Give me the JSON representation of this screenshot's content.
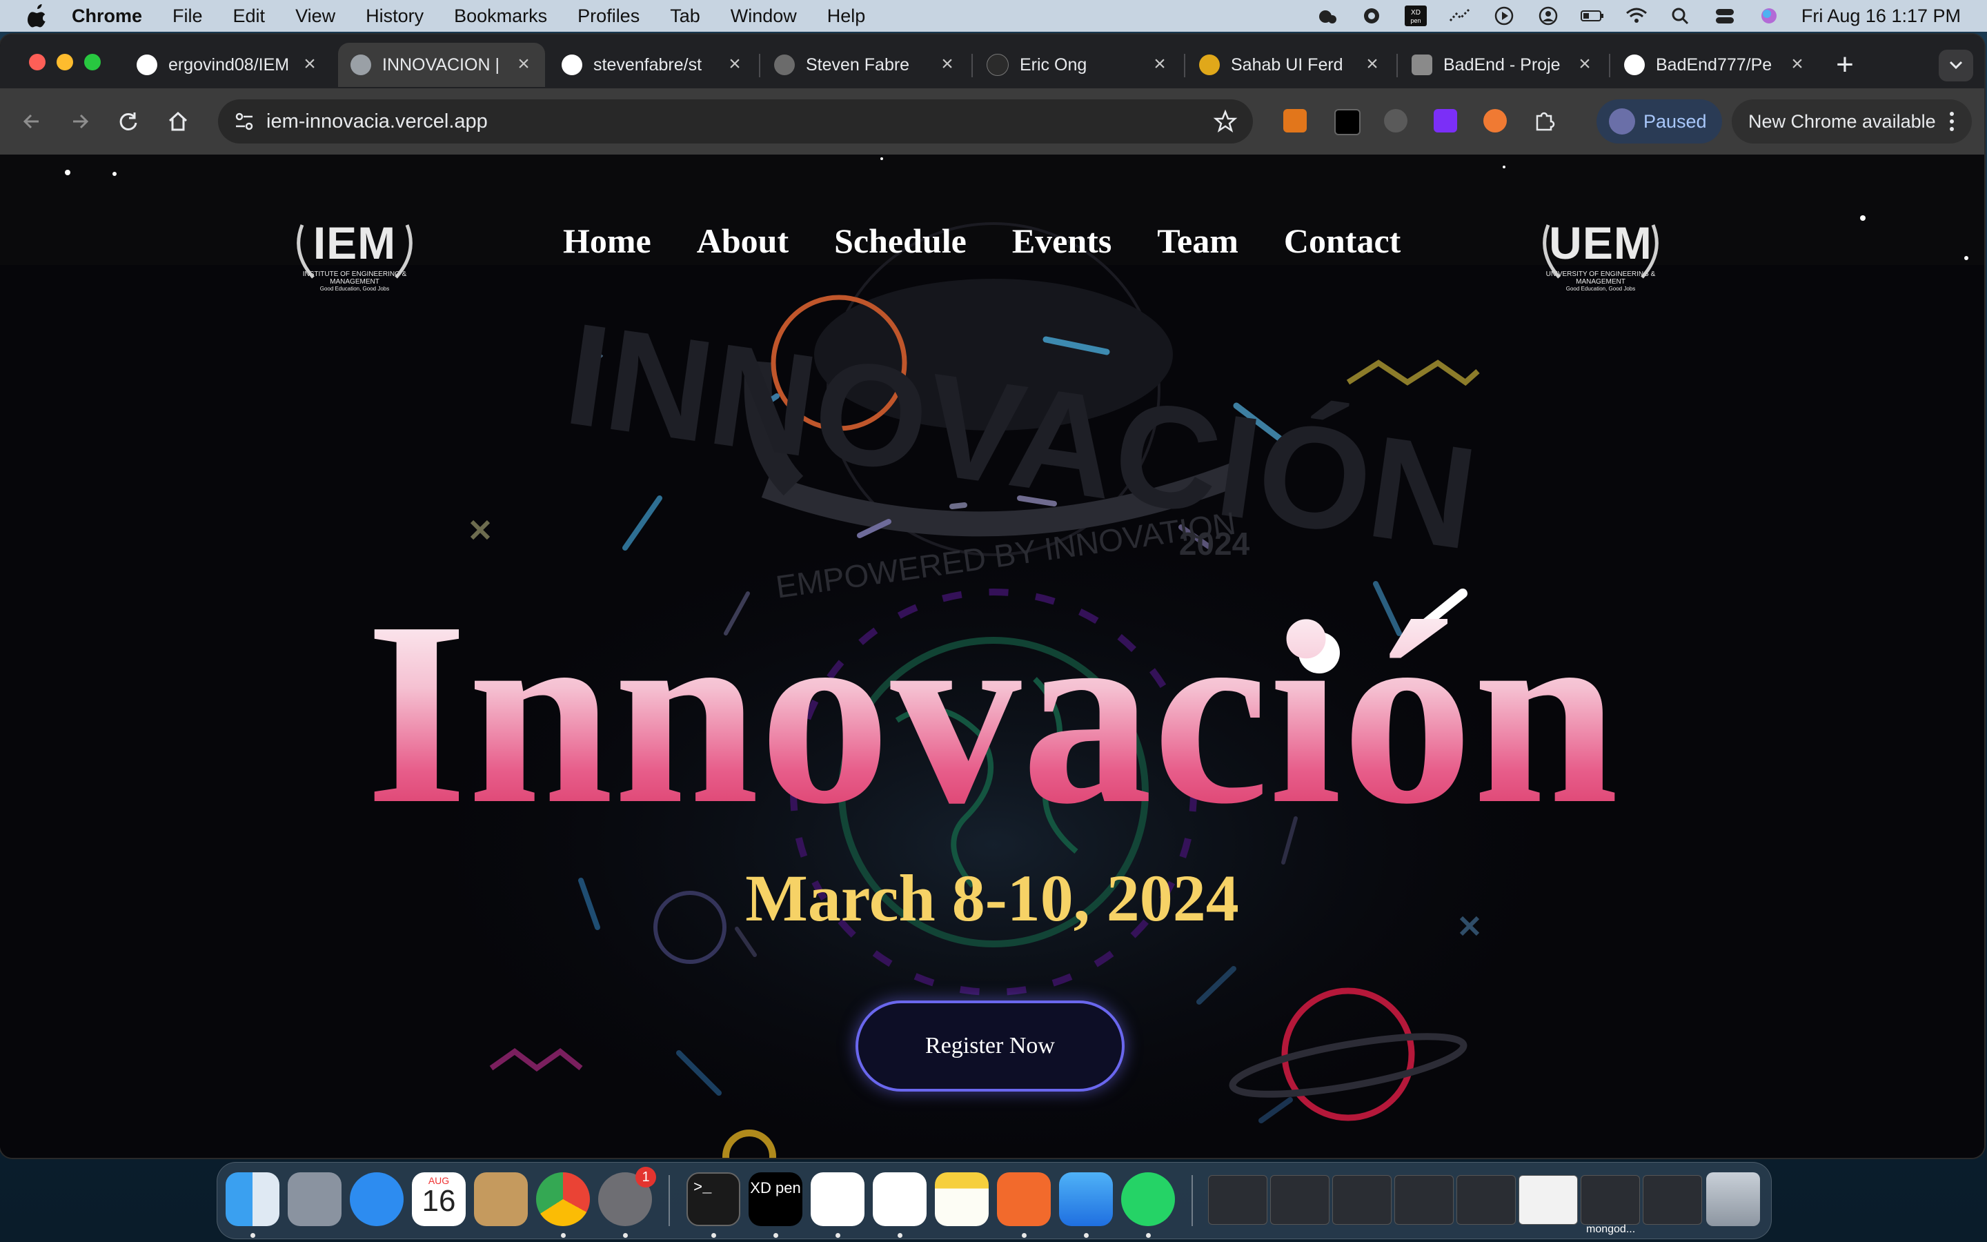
{
  "menubar": {
    "app_name": "Chrome",
    "menus": [
      "File",
      "Edit",
      "View",
      "History",
      "Bookmarks",
      "Profiles",
      "Tab",
      "Window",
      "Help"
    ],
    "clock": "Fri Aug 16  1:17 PM"
  },
  "tabs": [
    {
      "label": "ergovind08/IEM",
      "favicon": "github-icon"
    },
    {
      "label": "INNOVACION |",
      "favicon": "globe-icon"
    },
    {
      "label": "stevenfabre/st",
      "favicon": "github-icon"
    },
    {
      "label": "Steven Fabre",
      "favicon": "avatar-icon"
    },
    {
      "label": "Eric Ong",
      "favicon": "eo-icon"
    },
    {
      "label": "Sahab UI Ferd",
      "favicon": "sf-icon"
    },
    {
      "label": "BadEnd - Proje",
      "favicon": "app-icon"
    },
    {
      "label": "BadEnd777/Pe",
      "favicon": "github-icon"
    }
  ],
  "toolbar": {
    "url": "iem-innovacia.vercel.app",
    "profile_status": "Paused",
    "update_label": "New Chrome available"
  },
  "site": {
    "logo_left": {
      "text": "IEM",
      "caption": "INSTITUTE OF ENGINEERING & MANAGEMENT",
      "tagline": "Good Education, Good Jobs"
    },
    "logo_right": {
      "text": "UEM",
      "caption": "UNIVERSITY OF ENGINEERING & MANAGEMENT",
      "tagline": "Good Education, Good Jobs"
    },
    "nav": [
      "Home",
      "About",
      "Schedule",
      "Events",
      "Team",
      "Contact"
    ],
    "bg_logo_text": "INNOVACIÓN",
    "bg_logo_sub": "EMPOWERED BY INNOVATION",
    "bg_logo_year": "2024",
    "hero_title": "Innovación",
    "hero_date": "March 8-10, 2024",
    "cta": "Register Now"
  },
  "dock": {
    "calendar_month": "AUG",
    "calendar_day": "16",
    "settings_badge": "1",
    "xd_label": "XD pen",
    "mongo_caption": "mongod..."
  },
  "colors": {
    "accent_pink": "#e0456f",
    "date_yellow": "#f6d266",
    "cta_border": "#6a67ee"
  }
}
